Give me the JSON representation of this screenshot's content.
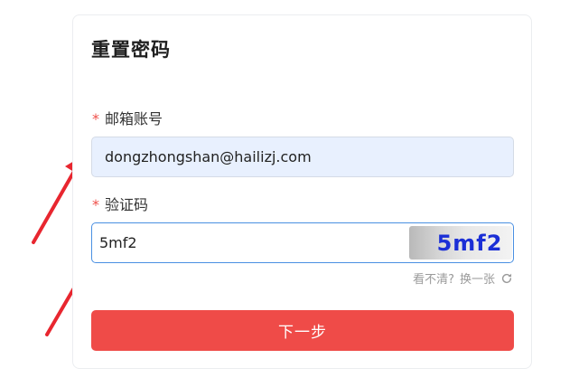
{
  "form": {
    "title": "重置密码",
    "email": {
      "required_mark": "*",
      "label": "邮箱账号",
      "value": "dongzhongshan@hailizj.com"
    },
    "captcha": {
      "required_mark": "*",
      "label": "验证码",
      "value": "5mf2",
      "image_text": "5mf2"
    },
    "refresh": {
      "hint": "看不清?",
      "action": "换一张",
      "icon": "refresh-icon"
    },
    "submit_label": "下一步"
  },
  "annotations": {
    "arrow_color": "#e8262f",
    "arrow_count": 2
  },
  "colors": {
    "primary_button": "#ef4b48",
    "required": "#f0504a",
    "captcha_text": "#1b2fd6",
    "focus_border": "#4a90e2",
    "autofill_bg": "#e8f0fe"
  }
}
